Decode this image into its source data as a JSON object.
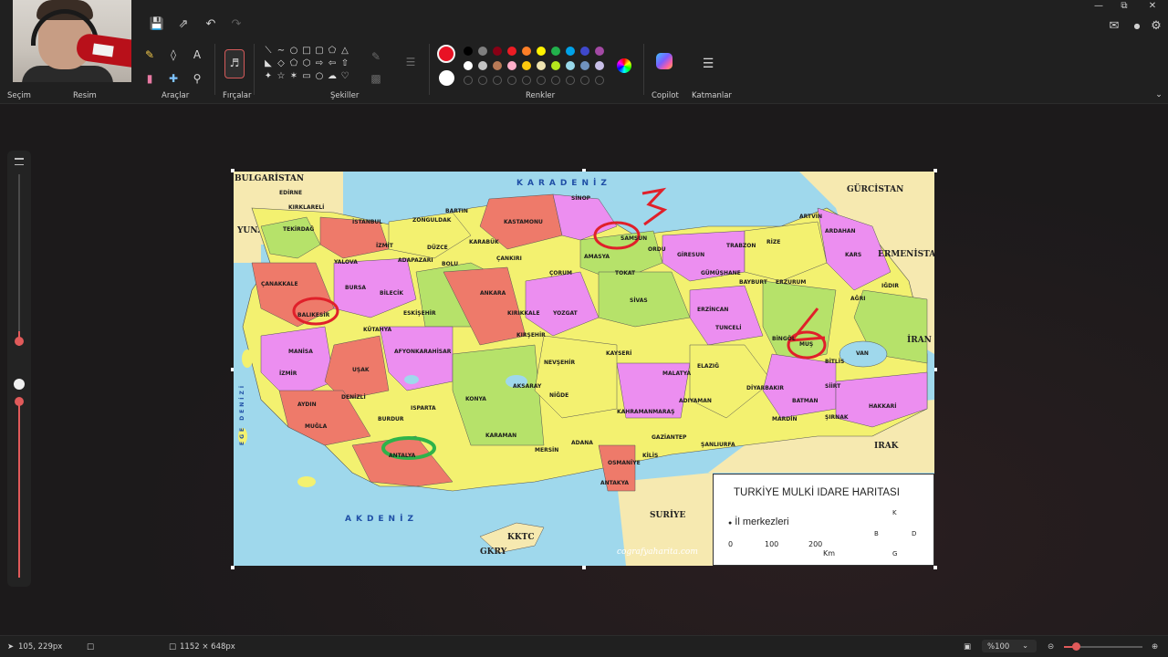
{
  "ribbon": {
    "groups": {
      "selection": "Seçim",
      "image": "Resim",
      "tools": "Araçlar",
      "brushes": "Fırçalar",
      "shapes": "Şekiller",
      "colors": "Renkler",
      "copilot": "Copilot",
      "layers": "Katmanlar"
    },
    "palette": {
      "primary": "#e81224",
      "secondary": "#ffffff",
      "row1": [
        "#000000",
        "#7f7f7f",
        "#880015",
        "#ed1c24",
        "#ff7f27",
        "#fff200",
        "#22b14c",
        "#00a2e8",
        "#3f48cc",
        "#a349a4"
      ],
      "row2": [
        "#ffffff",
        "#c3c3c3",
        "#b97a57",
        "#ffaec9",
        "#ffc90e",
        "#efe4b0",
        "#b5e61d",
        "#99d9ea",
        "#7092be",
        "#c8bfe7"
      ]
    }
  },
  "map": {
    "seas": {
      "black_sea": "KARADENİZ",
      "mediterranean": "AKDENİZ",
      "aegean": "EGE DENİZİ"
    },
    "countries": [
      {
        "id": "bulgaria",
        "label": "BULGARİSTAN"
      },
      {
        "id": "georgia",
        "label": "GÜRCİSTAN"
      },
      {
        "id": "armenia",
        "label": "ERMENİSTAN"
      },
      {
        "id": "greece",
        "label": "YUN."
      },
      {
        "id": "iran",
        "label": "İRAN"
      },
      {
        "id": "iraq",
        "label": "IRAK"
      },
      {
        "id": "syria",
        "label": "SURİYE"
      },
      {
        "id": "kktc",
        "label": "KKTC"
      },
      {
        "id": "gkry",
        "label": "GKRY"
      }
    ],
    "provinces": [
      "EDİRNE",
      "KIRKLARELİ",
      "TEKİRDAĞ",
      "İSTANBUL",
      "ZONGULDAK",
      "BARTIN",
      "KASTAMONU",
      "SİNOP",
      "ARTVİN",
      "ARDAHAN",
      "KARABÜK",
      "DÜZCE",
      "İZMİT",
      "YALOVA",
      "ADAPAZARI",
      "BOLU",
      "ÇANKIRI",
      "ÇORUM",
      "AMASYA",
      "SAMSUN",
      "ORDU",
      "GİRESUN",
      "TRABZON",
      "RİZE",
      "KARS",
      "IĞDIR",
      "ÇANAKKALE",
      "BURSA",
      "BİLECİK",
      "ESKİŞEHİR",
      "ANKARA",
      "KIRIKKALE",
      "YOZGAT",
      "TOKAT",
      "SİVAS",
      "GÜMÜŞHANE",
      "BAYBURT",
      "ERZURUM",
      "AĞRI",
      "ERZİNCAN",
      "TUNCELİ",
      "BİNGÖL",
      "MUŞ",
      "VAN",
      "BİTLİS",
      "BALIKESİR",
      "KÜTAHYA",
      "MANİSA",
      "UŞAK",
      "AFYONKARAHİSAR",
      "KIRŞEHİR",
      "NEVŞEHİR",
      "KAYSERİ",
      "MALATYA",
      "ELAZIĞ",
      "İZMİR",
      "DENİZLİ",
      "AYDIN",
      "MUĞLA",
      "ISPARTA",
      "BURDUR",
      "KONYA",
      "AKSARAY",
      "NİĞDE",
      "ADIYAMAN",
      "DİYARBAKIR",
      "BATMAN",
      "SİİRT",
      "HAKKARİ",
      "KAHRAMANMARAŞ",
      "MARDİN",
      "ŞIRNAK",
      "KARAMAN",
      "ADANA",
      "OSMANİYE",
      "GAZİANTEP",
      "ŞANLIURFA",
      "KİLİS",
      "MERSİN",
      "ANTALYA",
      "ANTAKYA"
    ],
    "legend": {
      "title": "TURKİYE MULKİ IDARE HARITASI",
      "marker": "İl merkezleri",
      "scale": [
        "0",
        "100",
        "200"
      ],
      "unit": "Km",
      "compass": {
        "n": "K",
        "s": "G",
        "e": "D",
        "w": "B"
      }
    },
    "watermark": "cografyaharita.com",
    "annotations": [
      {
        "id": "three",
        "label": "3",
        "color": "#e0202a"
      },
      {
        "id": "four",
        "label": "4",
        "color": "#e0202a"
      }
    ]
  },
  "status": {
    "cursor": "105, 229px",
    "canvas_size": "1152 × 648px",
    "zoom": "%100"
  }
}
